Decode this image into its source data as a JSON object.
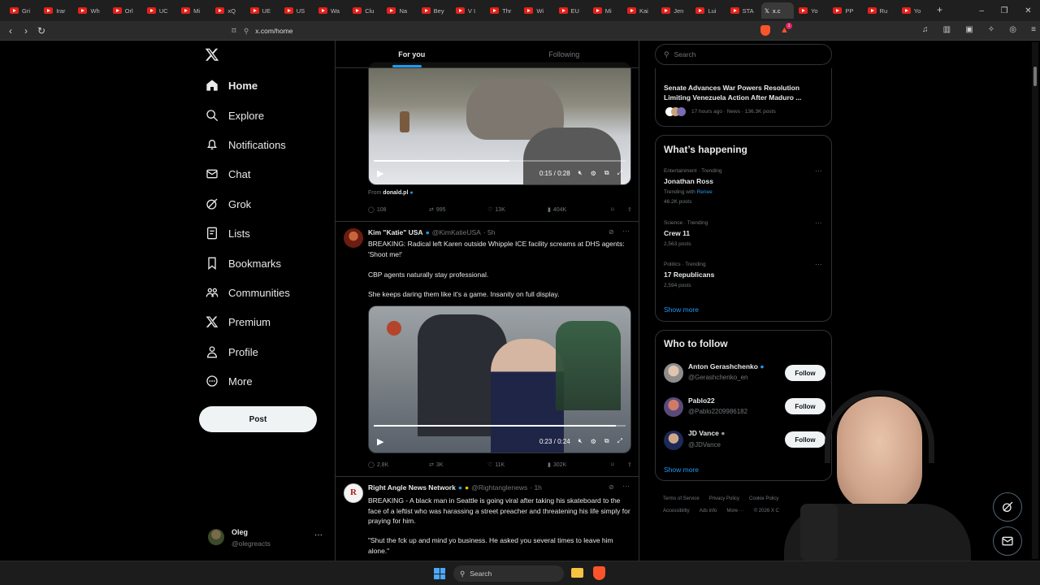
{
  "browser": {
    "tabs": [
      {
        "label": "Gri"
      },
      {
        "label": "Irar"
      },
      {
        "label": "Wh"
      },
      {
        "label": "Orl"
      },
      {
        "label": "UC"
      },
      {
        "label": "Mi"
      },
      {
        "label": "xQ"
      },
      {
        "label": "UE"
      },
      {
        "label": "US"
      },
      {
        "label": "Wa"
      },
      {
        "label": "Clu"
      },
      {
        "label": "Na"
      },
      {
        "label": "Bey"
      },
      {
        "label": "V I"
      },
      {
        "label": "Thr"
      },
      {
        "label": "Wi"
      },
      {
        "label": "EU"
      },
      {
        "label": "Mi"
      },
      {
        "label": "Kai"
      },
      {
        "label": "Jen"
      },
      {
        "label": "Lui"
      },
      {
        "label": "STA"
      },
      {
        "label": "x.c"
      },
      {
        "label": "Yo"
      },
      {
        "label": "PP"
      },
      {
        "label": "Ru"
      },
      {
        "label": "Yo"
      }
    ],
    "url": "x.com/home",
    "notification_count": "1"
  },
  "nav": {
    "logo": "X",
    "items": [
      {
        "label": "Home",
        "icon": "home-icon"
      },
      {
        "label": "Explore",
        "icon": "search-icon"
      },
      {
        "label": "Notifications",
        "icon": "bell-icon"
      },
      {
        "label": "Chat",
        "icon": "mail-icon"
      },
      {
        "label": "Grok",
        "icon": "grok-icon"
      },
      {
        "label": "Lists",
        "icon": "list-icon"
      },
      {
        "label": "Bookmarks",
        "icon": "bookmark-icon"
      },
      {
        "label": "Communities",
        "icon": "people-icon"
      },
      {
        "label": "Premium",
        "icon": "x-icon"
      },
      {
        "label": "Profile",
        "icon": "person-icon"
      },
      {
        "label": "More",
        "icon": "more-circle-icon"
      }
    ],
    "post_label": "Post",
    "account": {
      "name": "Oleg",
      "handle": "@olegreacts"
    }
  },
  "feed": {
    "tabs": [
      "For you",
      "Following"
    ],
    "tweet1": {
      "video_time": "0:15 / 0:28",
      "video_progress": 0.54,
      "from_label": "From",
      "from_source": "donald.pl",
      "replies": "108",
      "reposts": "995",
      "likes": "13K",
      "views": "404K"
    },
    "tweet2": {
      "name": "Kim \"Katie\" USA",
      "handle": "@KimKatieUSA",
      "time": "· 5h",
      "text1": "BREAKING: Radical left Karen outside Whipple ICE facility screams at DHS agents: 'Shoot me!'",
      "text2": "CBP agents naturally stay professional.",
      "text3": "She keeps daring them like it's a game.  Insanity on full display.",
      "video_time": "0:23 / 0:24",
      "video_progress": 0.96,
      "replies": "2.8K",
      "reposts": "3K",
      "likes": "11K",
      "views": "302K"
    },
    "tweet3": {
      "name": "Right Angle News Network",
      "handle": "@Rightanglenews",
      "time": "· 1h",
      "text1": "BREAKING - A black man in Seattle is going viral after taking his skateboard to the face of a leftist who was harassing a street preacher and threatening his life simply for praying for him.",
      "text2": "\"Shut the fck up and mind yo business. He asked you several times to leave him alone.\""
    }
  },
  "sidebar": {
    "search_placeholder": "Search",
    "top_story": {
      "title": "Senate Advances War Powers Resolution Limiting Venezuela Action After Maduro ...",
      "meta": "17 hours ago · News · 136.3K posts"
    },
    "happening": {
      "title": "What’s happening",
      "trends": [
        {
          "context": "Entertainment · Trending",
          "name": "Jonathan Ross",
          "with_label": "Trending with",
          "with": "Renee",
          "posts": "46.2K posts"
        },
        {
          "context": "Science · Trending",
          "name": "Crew 11",
          "posts": "2,563 posts"
        },
        {
          "context": "Politics · Trending",
          "name": "17 Republicans",
          "posts": "2,594 posts"
        }
      ],
      "show_more": "Show more"
    },
    "who_to_follow": {
      "title": "Who to follow",
      "users": [
        {
          "name": "Anton Gerashchenko",
          "handle": "@Gerashchenko_en",
          "button": "Follow"
        },
        {
          "name": "Pablo22",
          "handle": "@Pablo2209986182",
          "button": "Follow"
        },
        {
          "name": "JD Vance",
          "handle": "@JDVance",
          "button": "Follow"
        }
      ],
      "show_more": "Show more"
    },
    "footer": {
      "links1": [
        "Terms of Service",
        "Privacy Policy",
        "Cookie Policy"
      ],
      "links2": [
        "Accessibility",
        "Ads info",
        "More ···",
        "© 2026 X C"
      ]
    }
  },
  "taskbar": {
    "search_label": "Search"
  },
  "colors": {
    "accent": "#1d9bf0",
    "background": "#000000",
    "border": "#2f3336",
    "muted": "#71767b"
  }
}
